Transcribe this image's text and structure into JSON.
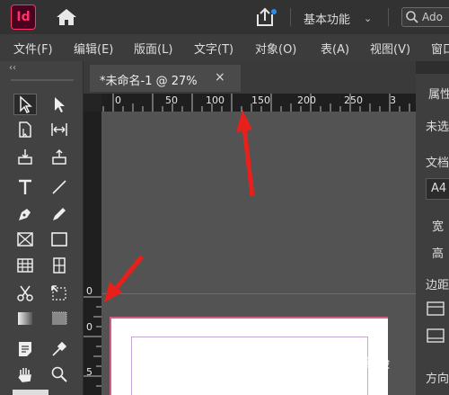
{
  "app": {
    "logo_text": "Id",
    "workspace": "基本功能",
    "search_label": "Ado"
  },
  "menu": [
    "文件(F)",
    "编辑(E)",
    "版面(L)",
    "文字(T)",
    "对象(O)",
    "表(A)",
    "视图(V)",
    "窗口"
  ],
  "toolbar": {
    "collapse": "‹‹",
    "tools": [
      "selection-tool",
      "direct-selection-tool",
      "page-tool",
      "gap-tool",
      "content-collector-tool",
      "content-placer-tool",
      "type-tool",
      "line-tool",
      "pen-tool",
      "pencil-tool",
      "rectangle-frame-tool",
      "rectangle-tool",
      "table-tool",
      "grid-tool",
      "scissors-tool",
      "free-transform-tool",
      "gradient-swatch-tool",
      "gradient-feather-tool",
      "note-tool",
      "eyedropper-tool",
      "hand-tool",
      "zoom-tool"
    ]
  },
  "document": {
    "tab_title": "*未命名-1 @ 27%",
    "close_glyph": "×",
    "h_ruler_labels": [
      "0",
      "50",
      "100",
      "150",
      "200",
      "250",
      "3"
    ],
    "v_ruler_labels": [
      "0",
      "0",
      "5"
    ]
  },
  "properties_panel": {
    "title": "属性",
    "no_selection": "未选",
    "doc_label": "文档",
    "page_size": "A4",
    "width_label": "宽",
    "height_label": "高",
    "margins_label": "边距",
    "orientation_label": "方向"
  },
  "watermark": "Bai 经验",
  "colors": {
    "accent": "#ff3366",
    "arrow": "#e8201c",
    "share_dot": "#2d8ceb"
  }
}
